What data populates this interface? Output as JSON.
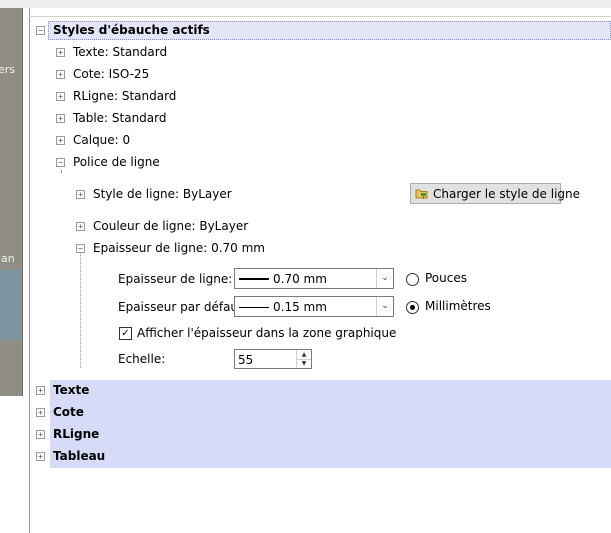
{
  "left_panel": {
    "labels": [
      "ers",
      "lan"
    ]
  },
  "root": {
    "label": "Styles d'ébauche actifs",
    "expander": "−"
  },
  "tree_items": [
    {
      "label": "Texte: Standard",
      "expander": "+"
    },
    {
      "label": "Cote: ISO-25",
      "expander": "+"
    },
    {
      "label": "RLigne: Standard",
      "expander": "+"
    },
    {
      "label": "Table: Standard",
      "expander": "+"
    },
    {
      "label": "Calque: 0",
      "expander": "+"
    },
    {
      "label": "Police de ligne",
      "expander": "−"
    }
  ],
  "police": {
    "style": {
      "label": "Style de ligne: ByLayer",
      "expander": "+"
    },
    "couleur": {
      "label": "Couleur de ligne: ByLayer",
      "expander": "+"
    },
    "epaisseur": {
      "label": "Epaisseur de ligne: 0.70 mm",
      "expander": "−"
    },
    "load_button": "Charger le style de ligne"
  },
  "epaisseur_panel": {
    "line_weight_label": "Epaisseur de ligne:",
    "line_weight_value": "0.70 mm",
    "default_weight_label": "Epaisseur par défaut:",
    "default_weight_value": "0.15 mm",
    "unit_inches": "Pouces",
    "unit_mm": "Millimètres",
    "unit_selected": "mm",
    "show_weight_label": "Afficher l'épaisseur dans la zone graphique",
    "show_weight_checked": true,
    "scale_label": "Echelle:",
    "scale_value": "55"
  },
  "sections": [
    {
      "label": "Texte",
      "expander": "+"
    },
    {
      "label": "Cote",
      "expander": "+"
    },
    {
      "label": "RLigne",
      "expander": "+"
    },
    {
      "label": "Tableau",
      "expander": "+"
    }
  ],
  "glyphs": {
    "check": "✓",
    "dropdown": "⌄",
    "spin_up": "▲",
    "spin_down": "▼"
  }
}
